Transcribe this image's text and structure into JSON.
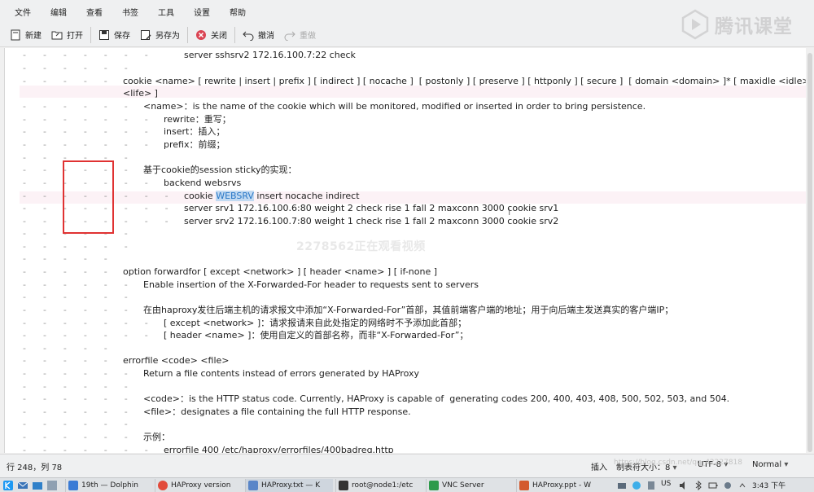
{
  "menu": [
    "文件",
    "编辑",
    "查看",
    "书签",
    "工具",
    "设置",
    "帮助"
  ],
  "toolbar": {
    "new": "新建",
    "open": "打开",
    "save": "保存",
    "save_as": "另存为",
    "close": "关闭",
    "undo": "撤消",
    "redo": "重做"
  },
  "logo_text": "腾讯课堂",
  "watermark": "2278562正在观看视频",
  "editor_lines": [
    {
      "gutter": "-      -      -      -      -      -      -",
      "text": "server sshsrv2 172.16.100.7:22 check",
      "indent": 220
    },
    {
      "gutter": "-      -      -      -      -      -",
      "text": "",
      "indent": 145
    },
    {
      "gutter": "-      -      -      -      -",
      "text": "cookie <name> [ rewrite | insert | prefix ] [ indirect ] [ nocache ]  [ postonly ] [ preserve ] [ httponly ] [ secure ]  [ domain <domain> ]* [ maxidle <idle> ] [ maxlife",
      "indent": 145
    },
    {
      "gutter": "",
      "text": "<life> ]",
      "indent": 145
    },
    {
      "gutter": "-      -      -      -      -      -",
      "text": "<name>：is the name of the cookie which will be monitored, modified or inserted in order to bring persistence.",
      "indent": 170
    },
    {
      "gutter": "-      -      -      -      -      -      -",
      "text": "rewrite：重写；",
      "indent": 195
    },
    {
      "gutter": "-      -      -      -      -      -      -",
      "text": "insert：插入；",
      "indent": 195
    },
    {
      "gutter": "-      -      -      -      -      -      -",
      "text": "prefix：前缀；",
      "indent": 195
    },
    {
      "gutter": "-      -      -      -      -      -",
      "text": "",
      "indent": 145
    },
    {
      "gutter": "-      -      -      -      -      -",
      "text": "基于cookie的session sticky的实现：",
      "indent": 170
    },
    {
      "gutter": "-      -      -      -      -      -      -",
      "text": "backend websrvs",
      "indent": 195
    },
    {
      "gutter": "-      -      -      -      -      -      -      -",
      "text": "cookie WEBSRV insert nocache indirect",
      "indent": 220,
      "selected": "WEBSRV"
    },
    {
      "gutter": "-      -      -      -      -      -      -      -",
      "text": "server srv1 172.16.100.6:80 weight 2 check rise 1 fall 2 maxconn 3000 cookie srv1",
      "indent": 220
    },
    {
      "gutter": "-      -      -      -      -      -      -      -",
      "text": "server srv2 172.16.100.7:80 weight 1 check rise 1 fall 2 maxconn 3000 cookie srv2",
      "indent": 220
    },
    {
      "gutter": "-      -      -      -      -      -",
      "text": "",
      "indent": 145
    },
    {
      "gutter": "-      -      -      -      -      -",
      "text": "",
      "indent": 145
    },
    {
      "gutter": "-      -      -      -      -",
      "text": "",
      "indent": 145
    },
    {
      "gutter": "-      -      -      -      -",
      "text": "option forwardfor [ except <network> ] [ header <name> ] [ if-none ]",
      "indent": 145
    },
    {
      "gutter": "-      -      -      -      -      -",
      "text": "Enable insertion of the X-Forwarded-For header to requests sent to servers",
      "indent": 170
    },
    {
      "gutter": "-      -      -      -      -      -",
      "text": "",
      "indent": 145
    },
    {
      "gutter": "-      -      -      -      -      -",
      "text": "在由haproxy发往后端主机的请求报文中添加“X-Forwarded-For”首部，其值前端客户端的地址；用于向后端主发送真实的客户端IP；",
      "indent": 170
    },
    {
      "gutter": "-      -      -      -      -      -      -",
      "text": "[ except <network> ]：请求报请来自此处指定的网络时不予添加此首部；",
      "indent": 195
    },
    {
      "gutter": "-      -      -      -      -      -      -",
      "text": "[ header <name> ]：使用自定义的首部名称，而非“X-Forwarded-For”；",
      "indent": 195
    },
    {
      "gutter": "-      -      -      -      -",
      "text": "",
      "indent": 145
    },
    {
      "gutter": "-      -      -      -      -",
      "text": "errorfile <code> <file>",
      "indent": 145
    },
    {
      "gutter": "-      -      -      -      -      -",
      "text": "Return a file contents instead of errors generated by HAProxy",
      "indent": 170
    },
    {
      "gutter": "-      -      -      -      -      -",
      "text": "",
      "indent": 145
    },
    {
      "gutter": "-      -      -      -      -      -",
      "text": "<code>：is the HTTP status code. Currently, HAProxy is capable of  generating codes 200, 400, 403, 408, 500, 502, 503, and 504.",
      "indent": 170
    },
    {
      "gutter": "-      -      -      -      -      -",
      "text": "<file>：designates a file containing the full HTTP response.",
      "indent": 170
    },
    {
      "gutter": "-      -      -      -      -      -",
      "text": "",
      "indent": 145
    },
    {
      "gutter": "-      -      -      -      -      -",
      "text": "示例：",
      "indent": 170
    },
    {
      "gutter": "-      -      -      -      -      -      -",
      "text": "errorfile 400 /etc/haproxy/errorfiles/400badreq.http",
      "indent": 195
    }
  ],
  "status": {
    "position": "行 248，列 78",
    "mode": "插入",
    "tab": "制表符大小：8",
    "encoding": "UTF-8",
    "syntax": "Normal",
    "url_watermark": "https://blog.csdn.net/qq_42227818"
  },
  "taskbar": {
    "tasks": [
      "19th — Dolphin",
      "HAProxy version",
      "HAProxy.txt — K",
      "root@node1:/etc",
      "VNC Server",
      "HAProxy.ppt - W"
    ],
    "lang": "US",
    "time": "3:43 下午"
  }
}
